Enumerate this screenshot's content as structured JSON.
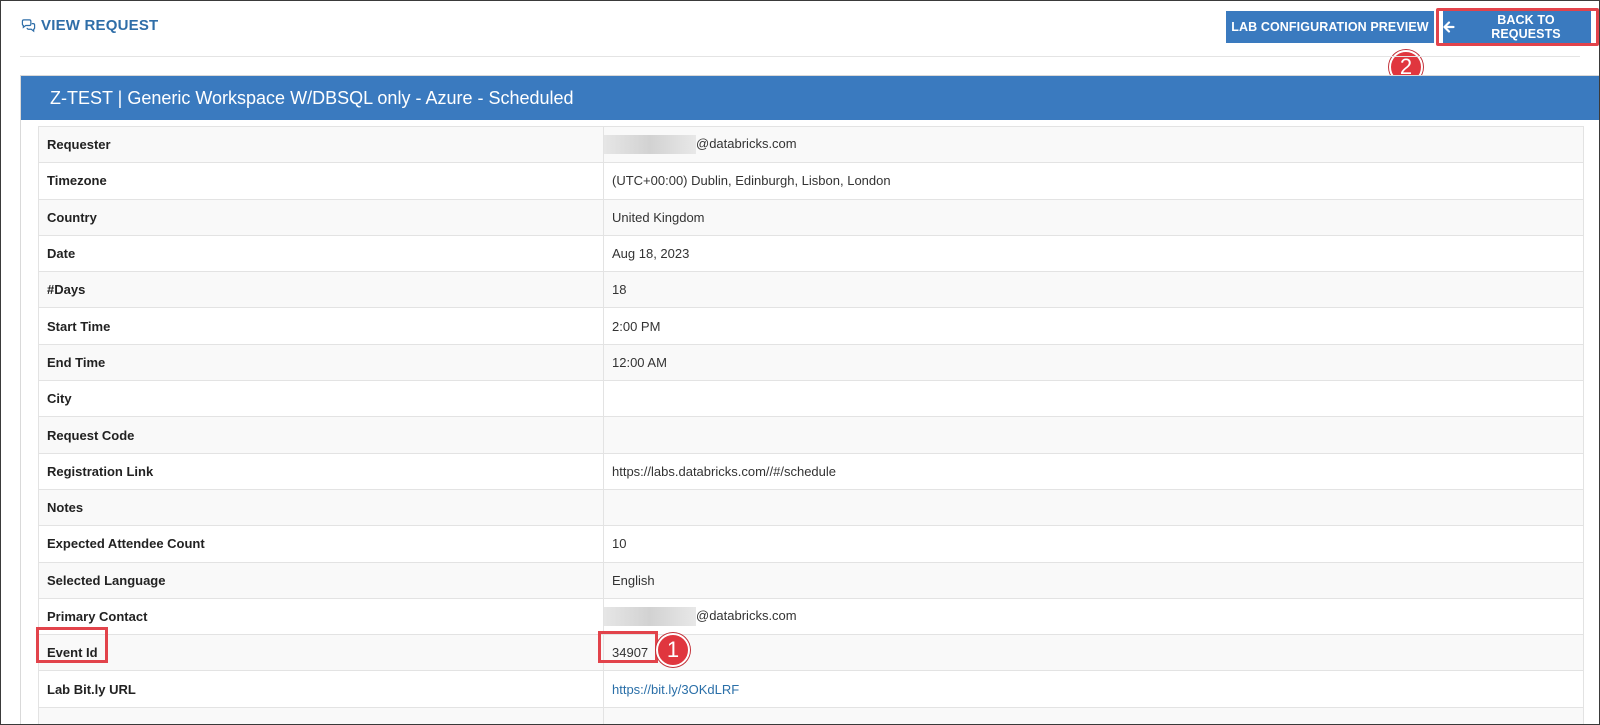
{
  "header": {
    "title": "VIEW REQUEST",
    "title_icon": "chat-bubbles-icon",
    "preview_button": "LAB CONFIGURATION PREVIEW",
    "back_button": "BACK TO REQUESTS",
    "back_icon": "arrow-left-icon"
  },
  "panel": {
    "title": "Z-TEST | Generic Workspace W/DBSQL only - Azure - Scheduled"
  },
  "rows": [
    {
      "label": "Requester",
      "value": "@databricks.com"
    },
    {
      "label": "Timezone",
      "value": "(UTC+00:00) Dublin, Edinburgh, Lisbon, London"
    },
    {
      "label": "Country",
      "value": "United Kingdom"
    },
    {
      "label": "Date",
      "value": "Aug 18, 2023"
    },
    {
      "label": "#Days",
      "value": "18"
    },
    {
      "label": "Start Time",
      "value": "2:00 PM"
    },
    {
      "label": "End Time",
      "value": "12:00 AM"
    },
    {
      "label": "City",
      "value": ""
    },
    {
      "label": "Request Code",
      "value": ""
    },
    {
      "label": "Registration Link",
      "value": "https://labs.databricks.com//#/schedule"
    },
    {
      "label": "Notes",
      "value": ""
    },
    {
      "label": "Expected Attendee Count",
      "value": "10"
    },
    {
      "label": "Selected Language",
      "value": "English"
    },
    {
      "label": "Primary Contact",
      "value": "@databricks.com"
    },
    {
      "label": "Event Id",
      "value": "34907"
    },
    {
      "label": "Lab Bit.ly URL",
      "value": "https://bit.ly/3OKdLRF"
    },
    {
      "label": "",
      "value": ""
    }
  ],
  "annotations": {
    "marker1": "1",
    "marker2": "2"
  },
  "colors": {
    "accent": "#3a7abf",
    "title_blue": "#2f6ea8",
    "highlight_red": "#e2434b"
  }
}
